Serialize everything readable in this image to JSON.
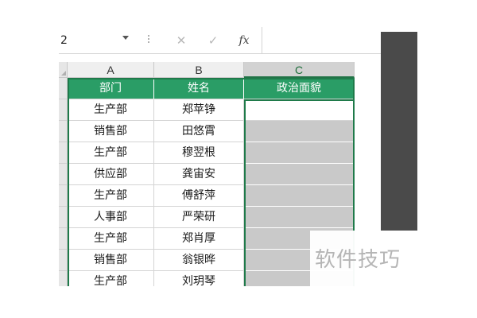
{
  "formula_bar": {
    "name_box": "2",
    "cancel_icon": "✕",
    "enter_icon": "✓",
    "fx_label": "fx",
    "formula_value": ""
  },
  "columns": [
    {
      "letter": "A"
    },
    {
      "letter": "B"
    },
    {
      "letter": "C"
    }
  ],
  "headers": [
    "部门",
    "姓名",
    "政治面貌"
  ],
  "rows": [
    {
      "dept": "生产部",
      "name": "郑苹铮",
      "political": ""
    },
    {
      "dept": "销售部",
      "name": "田悠霄",
      "political": ""
    },
    {
      "dept": "生产部",
      "name": "穆翌根",
      "political": ""
    },
    {
      "dept": "供应部",
      "name": "龚宙安",
      "political": ""
    },
    {
      "dept": "生产部",
      "name": "傅舒萍",
      "political": ""
    },
    {
      "dept": "人事部",
      "name": "严荣研",
      "political": ""
    },
    {
      "dept": "生产部",
      "name": "郑肖厚",
      "political": ""
    },
    {
      "dept": "销售部",
      "name": "翁银晔",
      "political": ""
    },
    {
      "dept": "生产部",
      "name": "刘玥琴",
      "political": ""
    }
  ],
  "watermark": "软件技巧",
  "colors": {
    "header_fill": "#2a9d66",
    "selection_border": "#1f7a4a",
    "selected_fill": "#c9c9c9"
  }
}
